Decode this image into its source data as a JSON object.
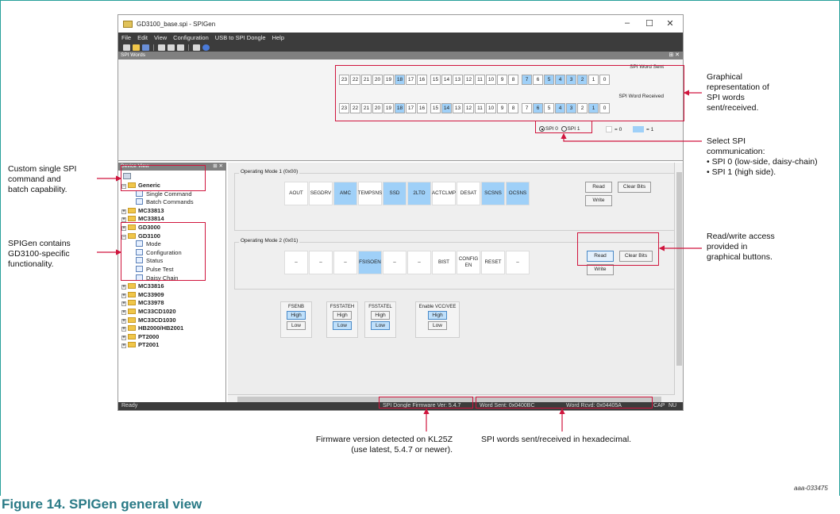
{
  "window": {
    "title": "GD3100_base.spi - SPIGen",
    "controls": [
      "–",
      "☐",
      "✕"
    ],
    "menu": [
      "File",
      "Edit",
      "View",
      "Configuration",
      "USB to SPI Dongle",
      "Help"
    ]
  },
  "spi_words": {
    "panel_title": "SPI Words",
    "sent_label": "SPI Word Sent",
    "received_label": "SPI Word Received",
    "bit_labels": [
      "23",
      "22",
      "21",
      "20",
      "19",
      "18",
      "17",
      "16",
      "15",
      "14",
      "13",
      "12",
      "11",
      "10",
      "9",
      "8",
      "7",
      "6",
      "5",
      "4",
      "3",
      "2",
      "1",
      "0"
    ],
    "sent_on": [
      "18",
      "7",
      "5",
      "4",
      "3",
      "2"
    ],
    "received_on": [
      "18",
      "14",
      "6",
      "4",
      "3",
      "1"
    ],
    "spi0_label": "SPI 0",
    "spi1_label": "SPI 1",
    "legend_off": "= 0",
    "legend_on": "= 1"
  },
  "device_view": {
    "title": "Device View",
    "tree": [
      {
        "label": "Generic",
        "level": 0,
        "expanded": true
      },
      {
        "label": "Single Command",
        "level": 1
      },
      {
        "label": "Batch Commands",
        "level": 1
      },
      {
        "label": "MC33813",
        "level": 0
      },
      {
        "label": "MC33814",
        "level": 0
      },
      {
        "label": "GD3000",
        "level": 0
      },
      {
        "label": "GD3100",
        "level": 0,
        "expanded": true
      },
      {
        "label": "Mode",
        "level": 1
      },
      {
        "label": "Configuration",
        "level": 1
      },
      {
        "label": "Status",
        "level": 1
      },
      {
        "label": "Pulse Test",
        "level": 1
      },
      {
        "label": "Daisy Chain",
        "level": 1
      },
      {
        "label": "MC33816",
        "level": 0
      },
      {
        "label": "MC33909",
        "level": 0
      },
      {
        "label": "MC33978",
        "level": 0
      },
      {
        "label": "MC33CD1020",
        "level": 0
      },
      {
        "label": "MC33CD1030",
        "level": 0
      },
      {
        "label": "HB2000/HB2001",
        "level": 0
      },
      {
        "label": "PT2000",
        "level": 0
      },
      {
        "label": "PT2001",
        "level": 0
      }
    ]
  },
  "main": {
    "mode1": {
      "label": "Operating Mode 1 (0x00)",
      "bits": [
        "AOUT",
        "SEGDRV",
        "AMC",
        "TEMPSNS",
        "SSD",
        "2LTO",
        "ACTCLMP",
        "DESAT",
        "SCSNS",
        "OCSNS"
      ],
      "on": [
        "AMC",
        "SSD",
        "2LTO",
        "SCSNS",
        "OCSNS"
      ]
    },
    "mode2": {
      "label": "Operating Mode 2 (0x01)",
      "bits": [
        "–",
        "–",
        "–",
        "FSISOEN",
        "–",
        "–",
        "BIST",
        "CONFIG EN",
        "RESET",
        "–"
      ],
      "on": [
        "FSISOEN"
      ]
    },
    "read_label": "Read",
    "clear_label": "Clear Bits",
    "write_label": "Write",
    "toggles": [
      {
        "title": "FSENB",
        "high": "High",
        "low": "Low",
        "selected": "High"
      },
      {
        "title": "FSSTATEH",
        "high": "High",
        "low": "Low",
        "selected": "Low"
      },
      {
        "title": "FSSTATEL",
        "high": "High",
        "low": "Low",
        "selected": "Low"
      },
      {
        "title": "Enable VCC/VEE",
        "high": "High",
        "low": "Low",
        "selected": "High"
      }
    ]
  },
  "status": {
    "ready": "Ready",
    "firmware": "SPI Dongle Firmware Ver: 5.4.7",
    "word_sent": "Word Sent: 0x0400BC",
    "word_rcvd": "Word Rcvd: 0x04405A",
    "caps": "CAP",
    "num": "NU"
  },
  "annotations": {
    "graphical": "Graphical\nrepresentation of\nSPI words\nsent/received.",
    "select_spi": "Select SPI\ncommunication:\n• SPI 0 (low-side, daisy-chain)\n• SPI 1 (high side).",
    "read_write": "Read/write access\nprovided in\ngraphical buttons.",
    "custom": "Custom single SPI\ncommand and\nbatch capability.",
    "spigen": "SPIGen contains\nGD3100-specific\nfunctionality.",
    "firmware": "Firmware version detected on KL25Z\n(use latest, 5.4.7 or newer).",
    "hex": "SPI words sent/received in hexadecimal."
  },
  "figure": {
    "id": "aaa-033475",
    "title": "Figure 14.  SPIGen general view"
  },
  "colors": {
    "accent_red": "#d0153d",
    "bit_on": "#9fd0f8",
    "frame": "#26a09a",
    "title": "#2a7a86"
  }
}
